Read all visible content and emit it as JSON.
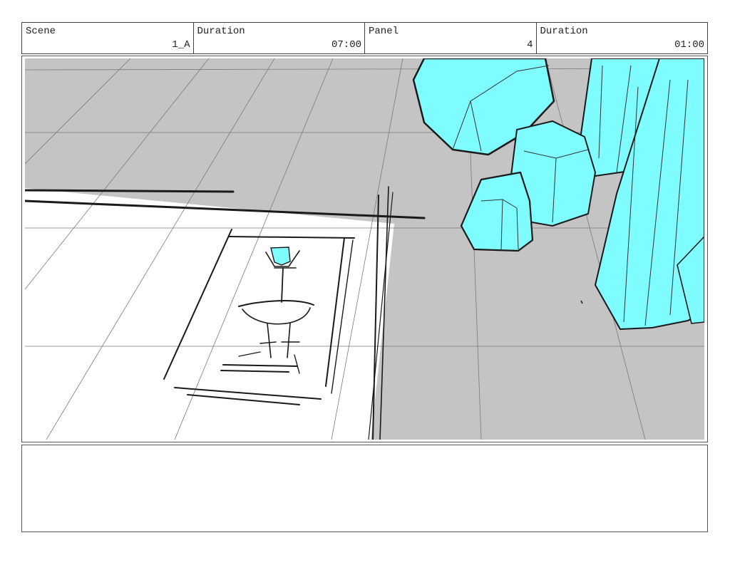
{
  "header": {
    "scene_label": "Scene",
    "scene_value": "1_A",
    "scene_duration_label": "Duration",
    "scene_duration_value": "07:00",
    "panel_label": "Panel",
    "panel_value": "4",
    "panel_duration_label": "Duration",
    "panel_duration_value": "01:00"
  },
  "notes": {
    "text": ""
  },
  "colors": {
    "crystal": "#7ffcff",
    "floor_shadow": "#c4c4c4",
    "ink": "#1a1a1a"
  }
}
